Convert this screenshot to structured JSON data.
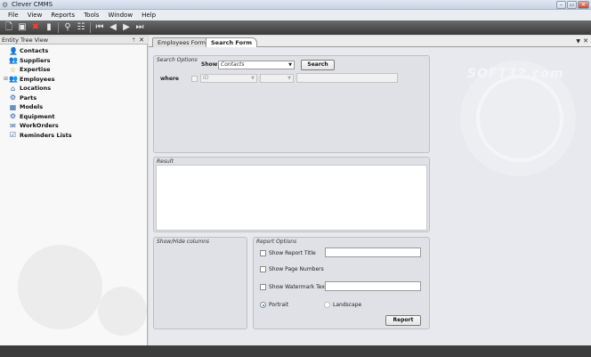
{
  "window": {
    "title": "Clever CMMS",
    "min": "–",
    "max": "▭",
    "close": "✕"
  },
  "menu": [
    "File",
    "View",
    "Reports",
    "Tools",
    "Window",
    "Help"
  ],
  "sidebar": {
    "title": "Entity Tree View",
    "pin": "ᛘ",
    "close": "✕",
    "items": [
      {
        "label": "Contacts",
        "icon": "👤"
      },
      {
        "label": "Suppliers",
        "icon": "👥"
      },
      {
        "label": "Expertise",
        "icon": "☆"
      },
      {
        "label": "Employees",
        "icon": "👥"
      },
      {
        "label": "Locations",
        "icon": "⌂"
      },
      {
        "label": "Parts",
        "icon": "⚙"
      },
      {
        "label": "Models",
        "icon": "▦"
      },
      {
        "label": "Equipment",
        "icon": "⚙"
      },
      {
        "label": "WorkOrders",
        "icon": "✉"
      },
      {
        "label": "Reminders Lists",
        "icon": "☑"
      }
    ]
  },
  "tabs": [
    {
      "label": "Employees Form",
      "active": false
    },
    {
      "label": "Search Form",
      "active": true
    }
  ],
  "search_options": {
    "title": "Search Options",
    "show_label": "Show",
    "show_value": "Contacts",
    "search_button": "Search",
    "where_label": "where",
    "field_value": "ID"
  },
  "result": {
    "title": "Result"
  },
  "show_hide": {
    "title": "Show/Hide columns"
  },
  "report_options": {
    "title": "Report Options",
    "show_report_title": "Show Report Title",
    "show_page_numbers": "Show Page Numbers",
    "show_watermark_text": "Show Watermark Text",
    "portrait": "Portrait",
    "landscape": "Landscape",
    "report_button": "Report"
  },
  "watermark": "SOFT32.com",
  "colors": {
    "toolbar": "#4a4a4a",
    "accent": "#3a6dc4",
    "close_red": "#ff3b2f"
  }
}
